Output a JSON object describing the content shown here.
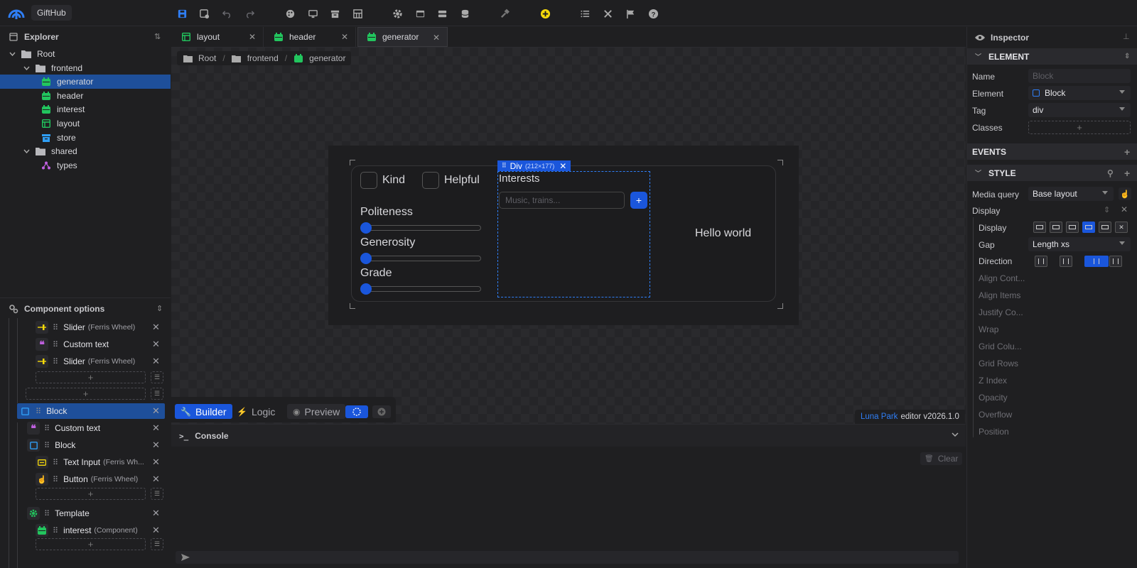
{
  "app": {
    "name": "GiftHub"
  },
  "explorer": {
    "title": "Explorer",
    "tree": [
      {
        "label": "Root",
        "type": "folder",
        "level": 0
      },
      {
        "label": "frontend",
        "type": "folder",
        "level": 1
      },
      {
        "label": "generator",
        "type": "component",
        "level": 2,
        "selected": true
      },
      {
        "label": "header",
        "type": "component",
        "level": 2
      },
      {
        "label": "interest",
        "type": "component",
        "level": 2
      },
      {
        "label": "layout",
        "type": "layout",
        "level": 2
      },
      {
        "label": "store",
        "type": "store",
        "level": 2
      },
      {
        "label": "shared",
        "type": "folder",
        "level": 1
      },
      {
        "label": "types",
        "type": "types",
        "level": 2
      }
    ]
  },
  "tabs": [
    {
      "label": "layout",
      "icon": "layout-icon"
    },
    {
      "label": "header",
      "icon": "component-icon"
    },
    {
      "label": "generator",
      "icon": "component-icon",
      "active": true
    }
  ],
  "breadcrumb": [
    "Root",
    "frontend",
    "generator"
  ],
  "preview": {
    "checkbox_kind": "Kind",
    "checkbox_helpful": "Helpful",
    "sliders": [
      "Politeness",
      "Generosity",
      "Grade"
    ],
    "interests_label": "Interests",
    "interests_placeholder": "Music, trains...",
    "hello": "Hello world",
    "selection_tag": "Div",
    "selection_size": "(212×177)"
  },
  "mode_bar": {
    "builder": "Builder",
    "logic": "Logic",
    "preview": "Preview"
  },
  "version": {
    "brand": "Luna Park",
    "rest": "editor v2026.1.0"
  },
  "console": {
    "title": "Console",
    "clear": "Clear"
  },
  "component_options": {
    "title": "Component options",
    "rows": [
      {
        "label": "Slider",
        "sub": "(Ferris Wheel)",
        "icon": "slider-icon"
      },
      {
        "label": "Custom text",
        "sub": "",
        "icon": "quote-icon"
      },
      {
        "label": "Slider",
        "sub": "(Ferris Wheel)",
        "icon": "slider-icon"
      },
      {
        "label": "Block",
        "sub": "",
        "icon": "block-icon"
      },
      {
        "label": "Custom text",
        "sub": "",
        "icon": "quote-icon"
      },
      {
        "label": "Block",
        "sub": "",
        "icon": "block-icon"
      },
      {
        "label": "Text Input",
        "sub": "(Ferris Wh...",
        "icon": "text-input-icon"
      },
      {
        "label": "Button",
        "sub": "(Ferris Wheel)",
        "icon": "pointer-icon"
      },
      {
        "label": "Template",
        "sub": "",
        "icon": "gear-icon"
      },
      {
        "label": "interest",
        "sub": "(Component)",
        "icon": "component-icon"
      }
    ]
  },
  "inspector": {
    "title": "Inspector",
    "element_section": "ELEMENT",
    "name_label": "Name",
    "name_placeholder": "Block",
    "element_label": "Element",
    "element_value": "Block",
    "tag_label": "Tag",
    "tag_value": "div",
    "classes_label": "Classes",
    "events_section": "EVENTS",
    "style_section": "STYLE",
    "media_label": "Media query",
    "media_value": "Base layout",
    "display_group": "Display",
    "display_label": "Display",
    "gap_label": "Gap",
    "gap_value": "Length xs",
    "direction_label": "Direction",
    "dim_props": [
      "Align Cont...",
      "Align Items",
      "Justify Co...",
      "Wrap",
      "Grid Colu...",
      "Grid Rows",
      "Z Index",
      "Opacity",
      "Overflow",
      "Position"
    ]
  },
  "colors": {
    "accent": "#1a56db",
    "selected": "#1e4f9a",
    "green": "#22c55e"
  }
}
